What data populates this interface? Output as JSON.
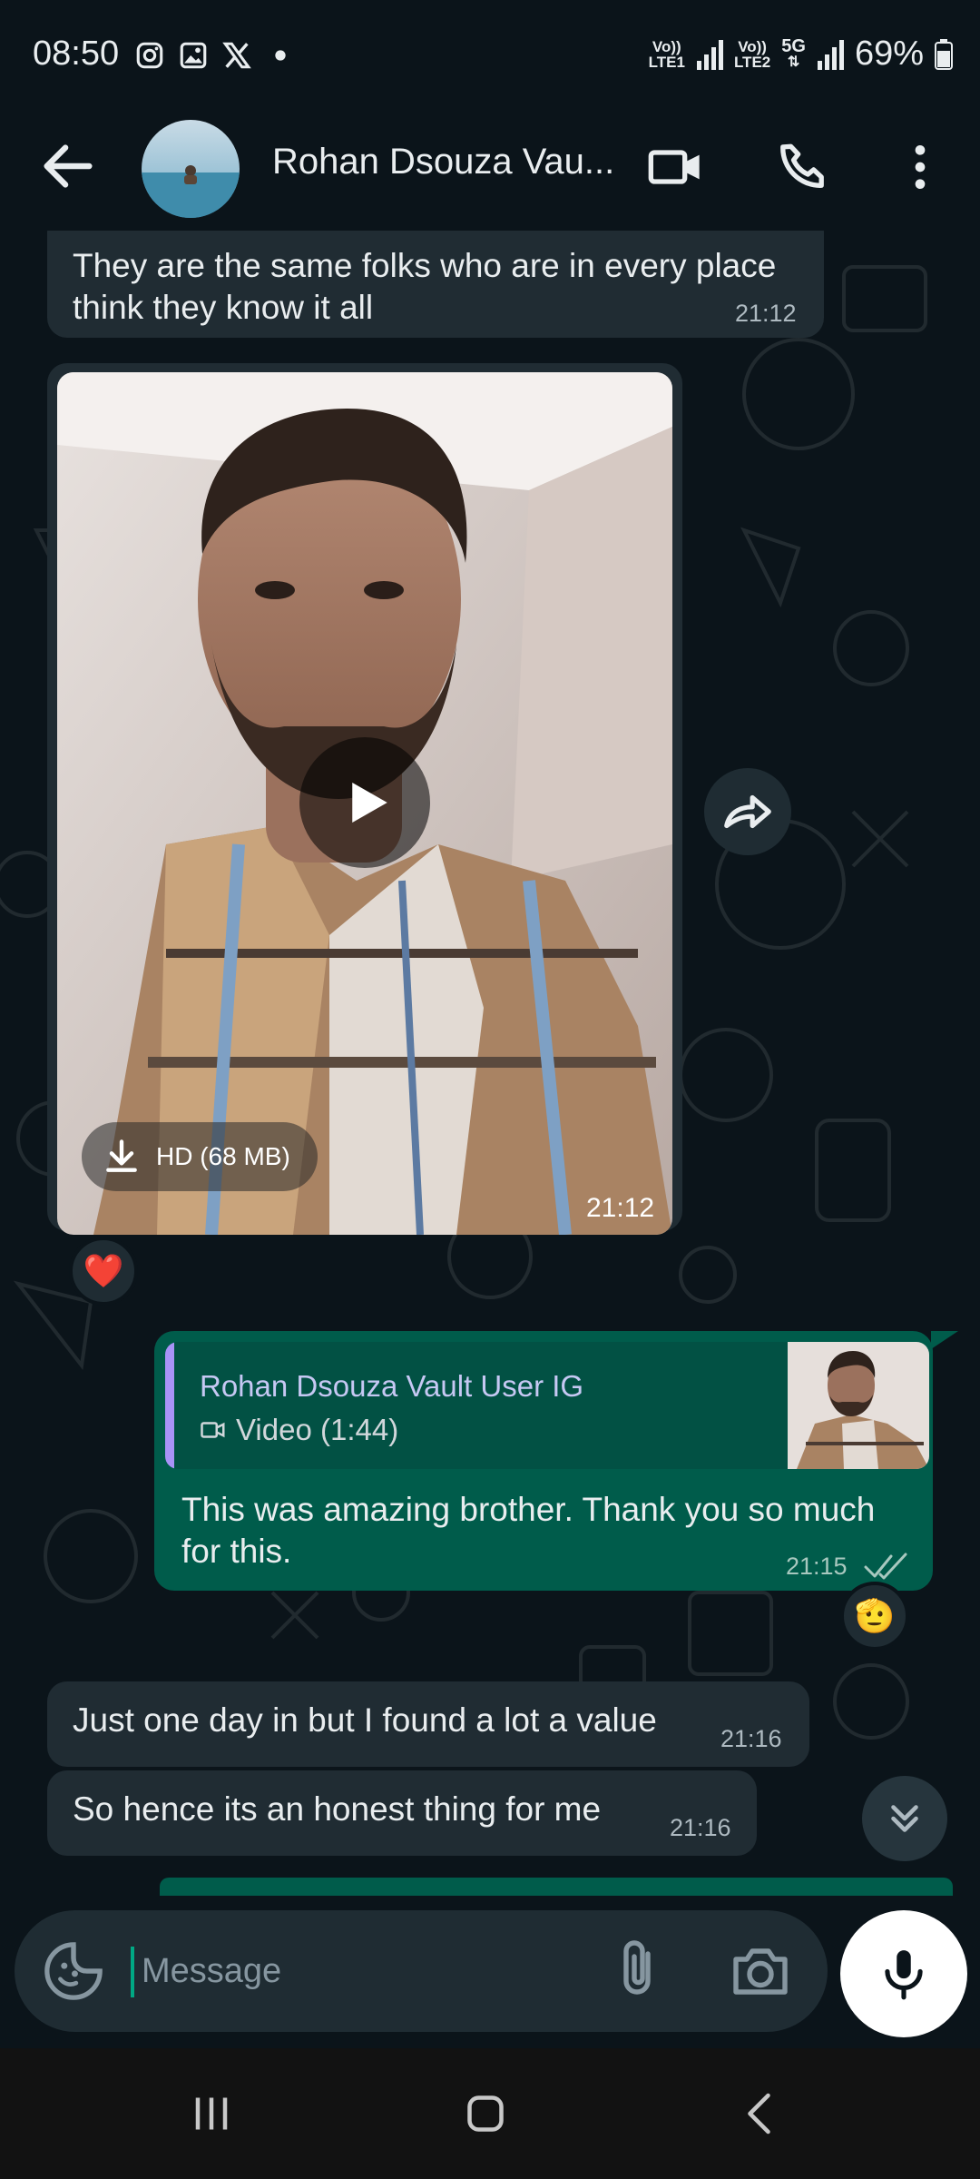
{
  "status_bar": {
    "time": "08:50",
    "sim1_label_top": "Vo))",
    "sim1_label_bottom": "LTE1",
    "sim2_label_top": "Vo))",
    "sim2_label_bottom": "LTE2",
    "network_label": "5G",
    "battery": "69%"
  },
  "header": {
    "contact_name": "Rohan Dsouza Vau..."
  },
  "messages": {
    "m1": {
      "text": "They are the same folks who are in every place think they know it all",
      "time": "21:12"
    },
    "video": {
      "hd_label": "HD (68 MB)",
      "time": "21:12",
      "reaction": "❤️"
    },
    "reply": {
      "quoted_author": "Rohan Dsouza Vault User IG",
      "quoted_label": "Video (1:44)",
      "text": "This was amazing brother. Thank you so much for this.",
      "time": "21:15",
      "reaction": "🫡"
    },
    "m3": {
      "text": "Just one day in but I found a lot a value",
      "time": "21:16"
    },
    "m4": {
      "text": "So hence its an honest thing for me",
      "time": "21:16"
    }
  },
  "composer": {
    "placeholder": "Message"
  },
  "colors": {
    "background": "#0b141a",
    "incoming_bubble": "#202c33",
    "outgoing_bubble": "#005c4b",
    "quote_bar": "#a893f7",
    "accent": "#00a884"
  }
}
